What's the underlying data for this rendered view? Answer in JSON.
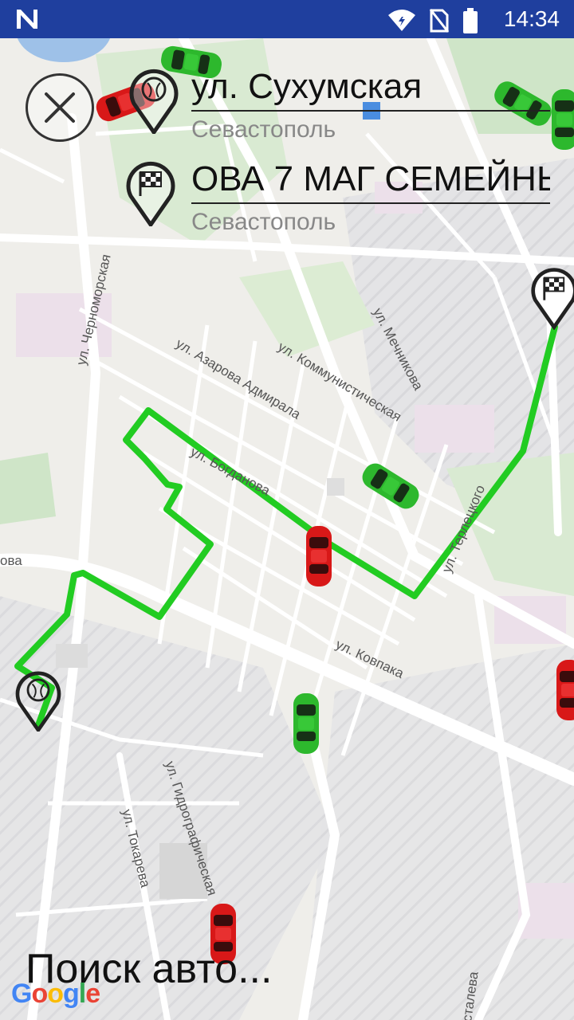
{
  "status_bar": {
    "time": "14:34",
    "icons": [
      "notification-n-icon",
      "wifi-icon",
      "no-sim-icon",
      "battery-icon"
    ]
  },
  "route": {
    "from": {
      "street": "ул. Сухумская",
      "city": "Севастополь"
    },
    "to": {
      "street": "ОВА 7 МАГ СЕМЕЙНЬ",
      "city": "Севастополь"
    }
  },
  "map": {
    "street_labels": [
      "ул. Черноморская",
      "ул. Азарова Адмирала",
      "ул. Коммунистическая",
      "ул. Мечникова",
      "ул. Ковпака",
      "ул. Гидрографическая",
      "ул. Токарева",
      "ул. Богданова",
      "ул. Терлецкого",
      "ова",
      "сталева"
    ],
    "route_color": "#22cc22",
    "car_colors": {
      "available": "#2db82d",
      "busy": "#d81818"
    }
  },
  "search_status": "Поиск авто...",
  "attribution": "Google"
}
